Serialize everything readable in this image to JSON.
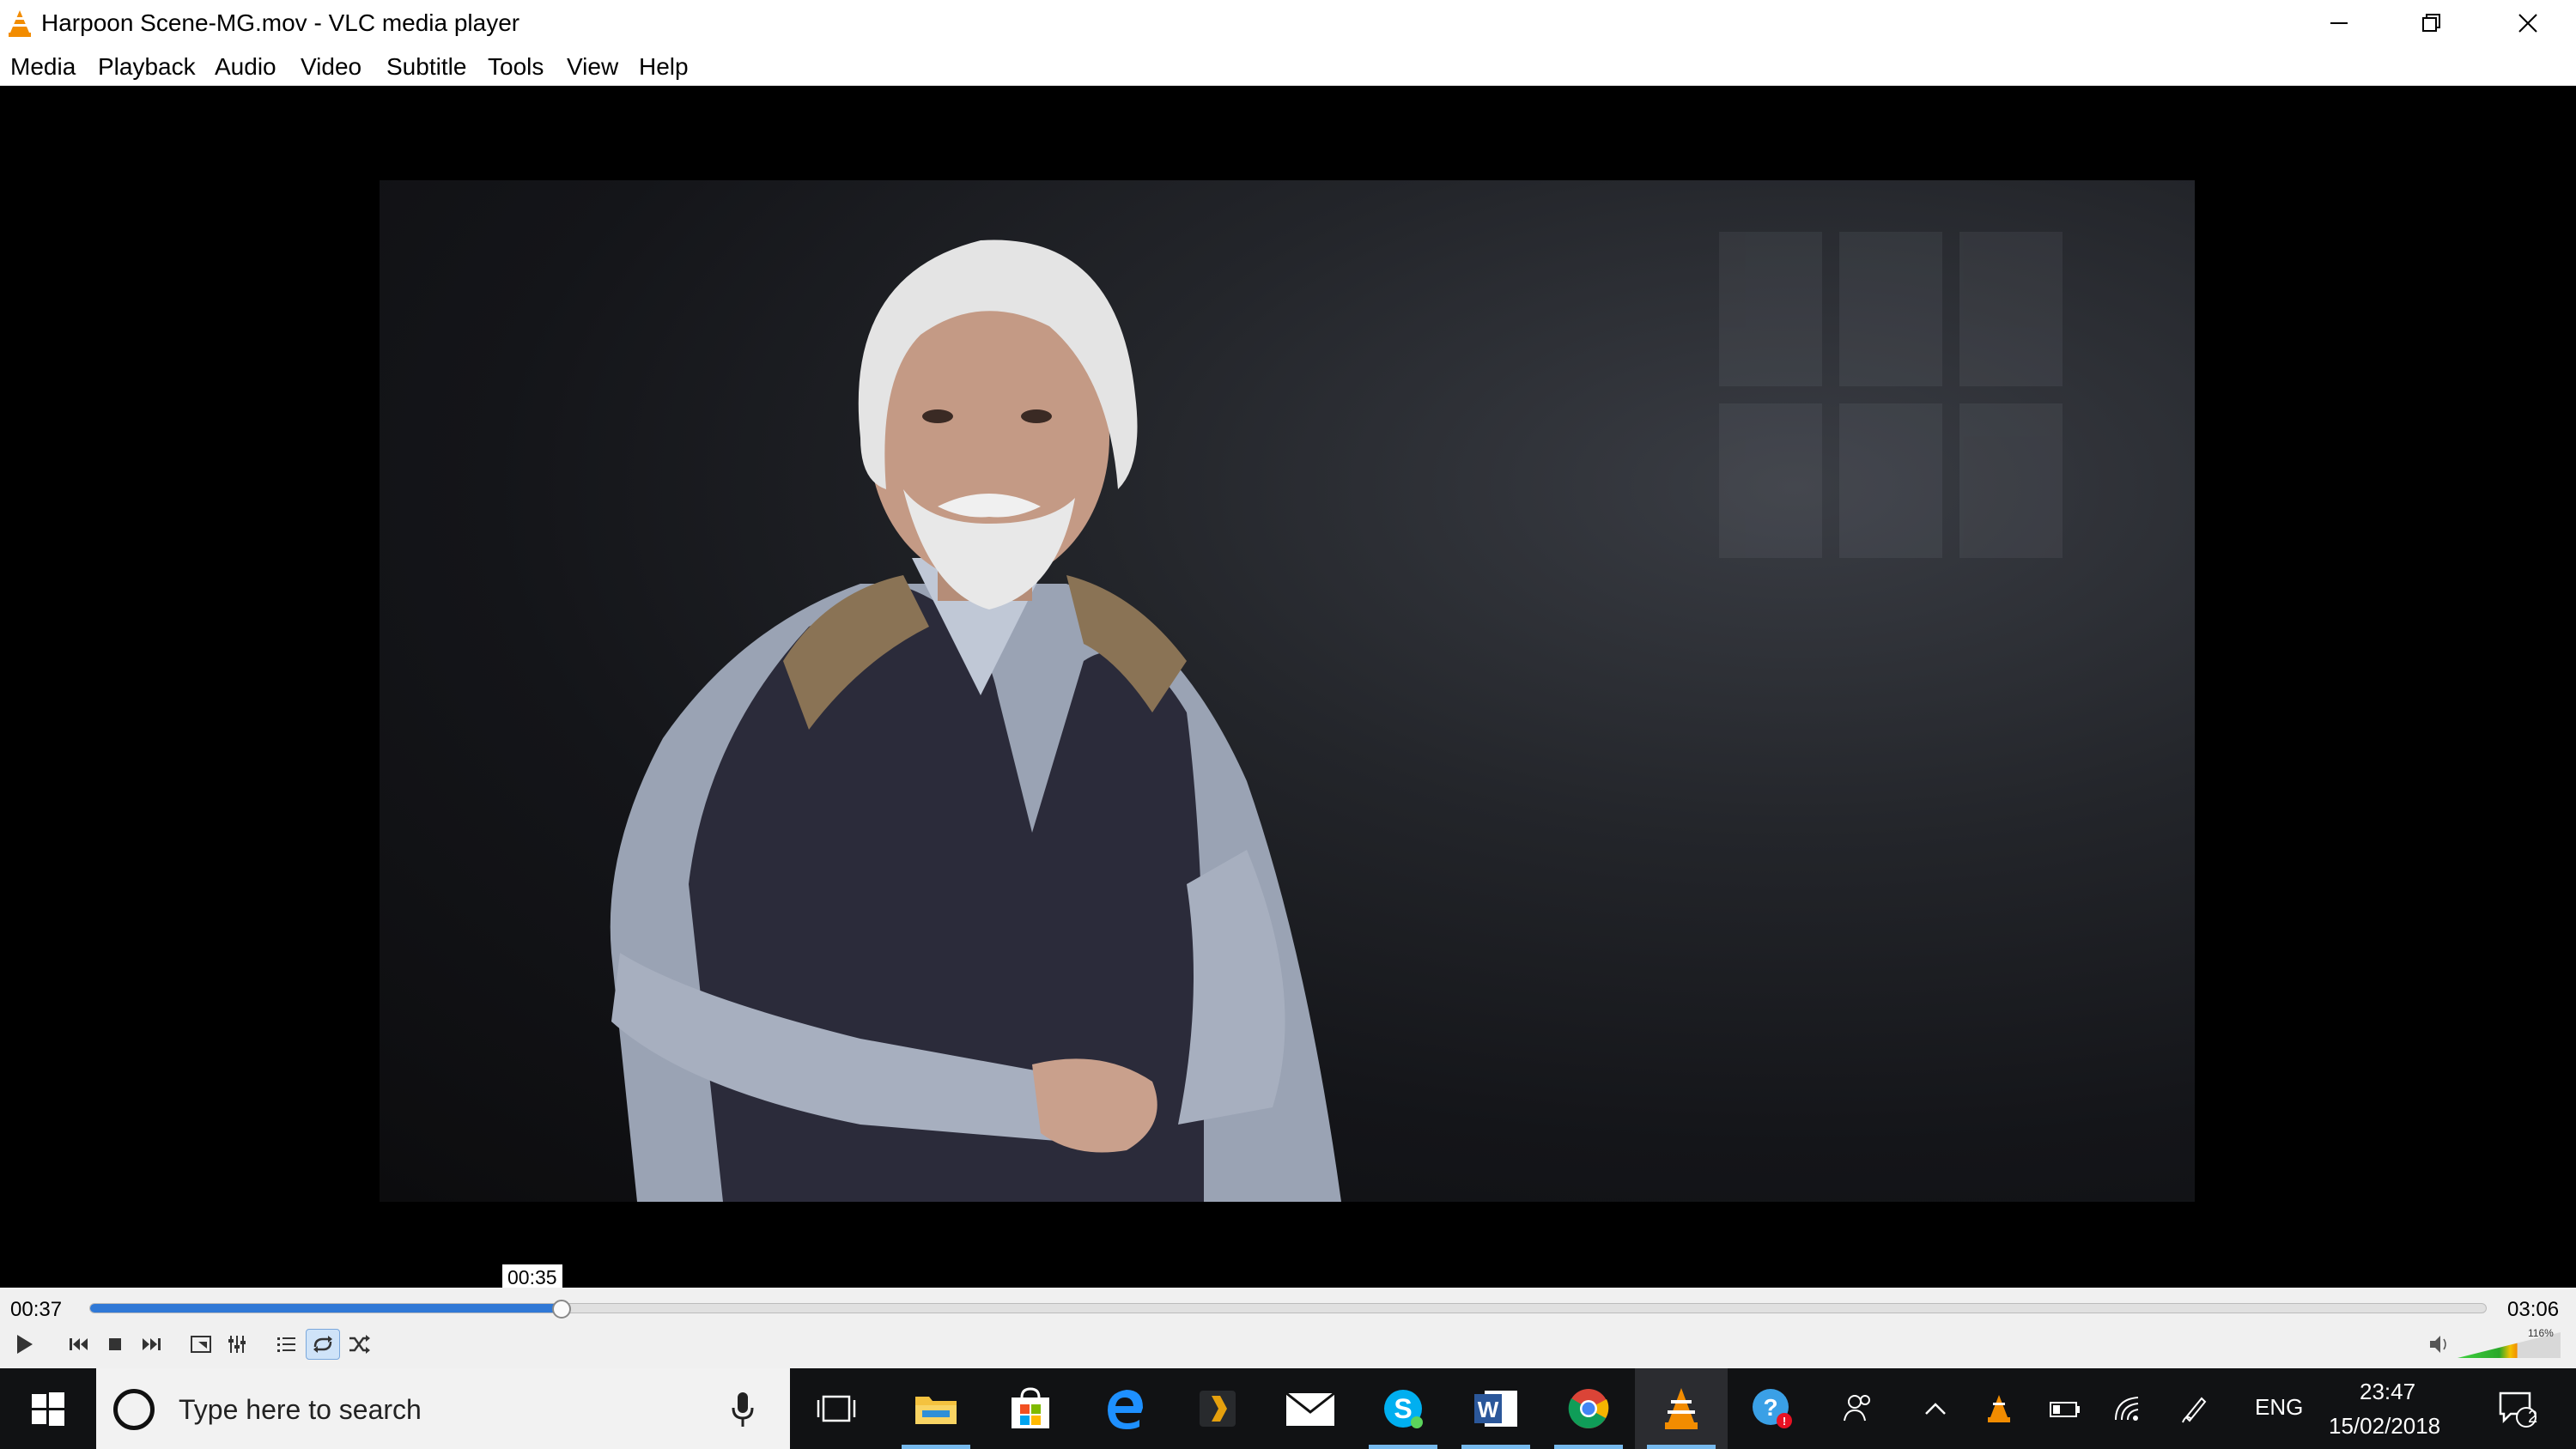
{
  "window": {
    "title": "Harpoon Scene-MG.mov - VLC media player"
  },
  "menu": [
    "Media",
    "Playback",
    "Audio",
    "Video",
    "Subtitle",
    "Tools",
    "View",
    "Help"
  ],
  "player": {
    "elapsed": "00:37",
    "total": "03:06",
    "progress_fraction": 0.197,
    "hover_time": "00:35",
    "volume_label": "116%",
    "volume_fraction": 0.58
  },
  "taskbar": {
    "search_placeholder": "Type here to search",
    "language": "ENG",
    "clock_time": "23:47",
    "clock_date": "15/02/2018",
    "notification_count": "2"
  },
  "colors": {
    "accent": "#2f78d6",
    "vlc_orange": "#f28c00",
    "taskbar_bg": "#111214"
  }
}
